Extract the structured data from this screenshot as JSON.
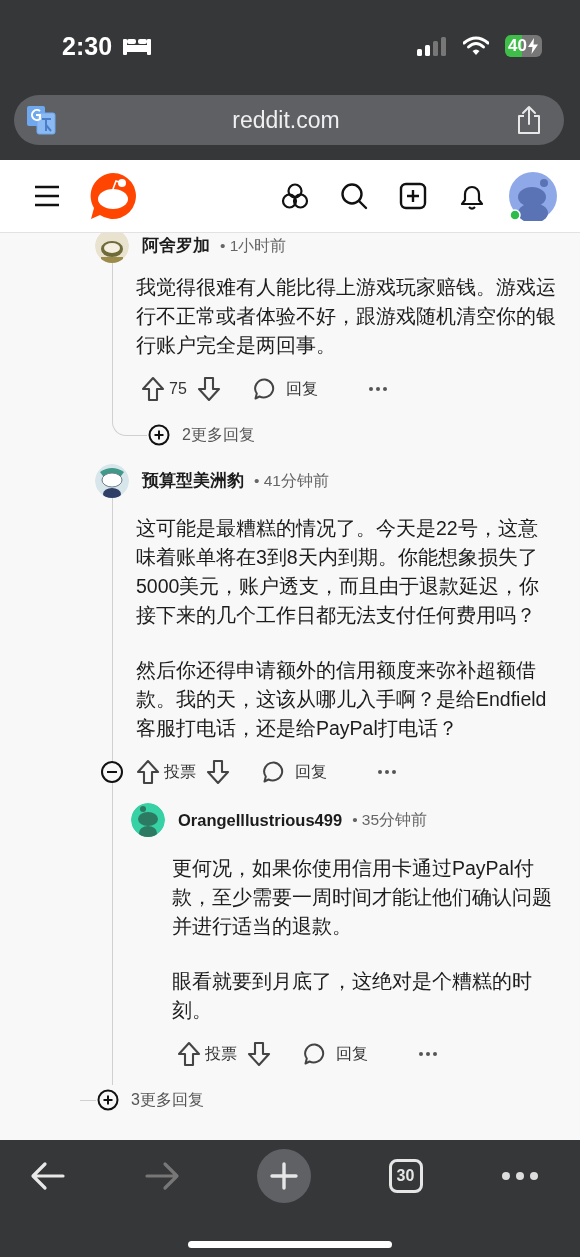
{
  "status_bar": {
    "time": "2:30",
    "battery": "40"
  },
  "address_bar": {
    "url": "reddit.com"
  },
  "comments": [
    {
      "author": "阿舍罗加",
      "time": "• 1小时前",
      "paragraphs": [
        "我觉得很难有人能比得上游戏玩家赔钱。游戏运行不正常或者体验不好，跟游戏随机清空你的银行账户完全是两回事。"
      ],
      "score": "75",
      "reply_label": "回复",
      "more_replies": "2更多回复"
    },
    {
      "author": "预算型美洲豹",
      "time": "• 41分钟前",
      "paragraphs": [
        "这可能是最糟糕的情况了。今天是22号，这意味着账单将在3到8天内到期。你能想象损失了5000美元，账户透支，而且由于退款延迟，你接下来的几个工作日都无法支付任何费用吗？",
        "然后你还得申请额外的信用额度来弥补超额借款。我的天，这该从哪儿入手啊？是给Endfield客服打电话，还是给PayPal打电话？"
      ],
      "score": "投票",
      "reply_label": "回复",
      "expanded": true,
      "replies": [
        {
          "author": "OrangeIllustrious499",
          "time": "• 35分钟前",
          "paragraphs": [
            "更何况，如果你使用信用卡通过PayPal付款，至少需要一周时间才能让他们确认问题并进行适当的退款。",
            "眼看就要到月底了，这绝对是个糟糕的时刻。"
          ],
          "score": "投票",
          "reply_label": "回复"
        }
      ],
      "more_replies": "3更多回复"
    }
  ],
  "toolbar": {
    "back_disabled": false,
    "forward_disabled": true,
    "tab_count": "30"
  }
}
